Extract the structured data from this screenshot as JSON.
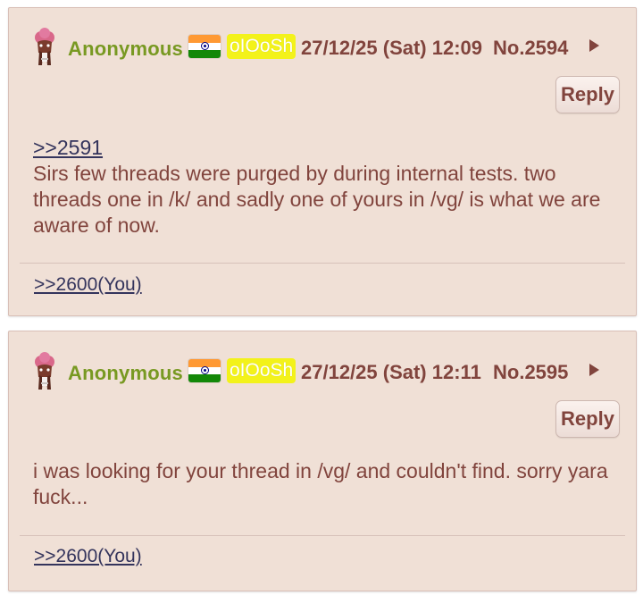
{
  "posts": [
    {
      "name": "Anonymous",
      "flag_icon": "india-flag-icon",
      "poster_id": "oIOoSh",
      "poster_id_color": "#f3f21a",
      "datetime": "27/12/25 (Sat) 12:09",
      "number": "No.2594",
      "reply_label": "Reply",
      "quote_link": ">>2591",
      "message": "Sirs few threads were purged by during internal tests. two threads one in /k/ and sadly one of yours in /vg/ is what we are aware of now.",
      "backlink": ">>2600(You)"
    },
    {
      "name": "Anonymous",
      "flag_icon": "india-flag-icon",
      "poster_id": "oIOoSh",
      "poster_id_color": "#f3f21a",
      "datetime": "27/12/25 (Sat) 12:11",
      "number": "No.2595",
      "reply_label": "Reply",
      "message": "i was looking for your thread in /vg/ and couldn't find. sorry yara fuck...",
      "backlink": ">>2600(You)"
    }
  ],
  "colors": {
    "post_bg": "#f0e0d6",
    "name": "#789922",
    "text": "#81443d",
    "link": "#34345c"
  }
}
